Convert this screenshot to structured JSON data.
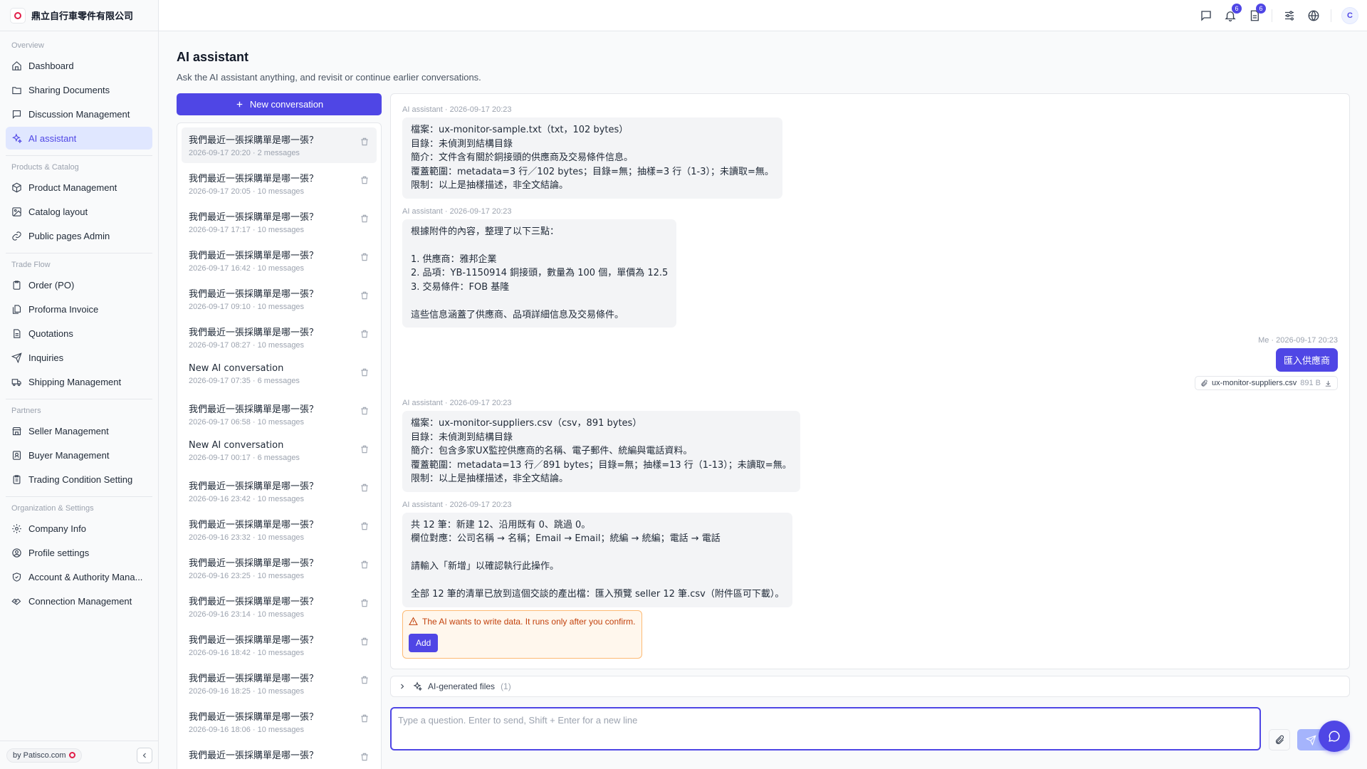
{
  "brand": {
    "name": "鼎立自行車零件有限公司"
  },
  "sidebar": {
    "sections": [
      {
        "title": "Overview",
        "items": [
          {
            "label": "Dashboard",
            "icon": "home-icon"
          },
          {
            "label": "Sharing Documents",
            "icon": "folder-icon"
          },
          {
            "label": "Discussion Management",
            "icon": "message-square-icon"
          },
          {
            "label": "AI assistant",
            "icon": "sparkles-icon",
            "active": true
          }
        ]
      },
      {
        "title": "Products & Catalog",
        "items": [
          {
            "label": "Product Management",
            "icon": "package-icon"
          },
          {
            "label": "Catalog layout",
            "icon": "image-icon"
          },
          {
            "label": "Public pages Admin",
            "icon": "link-icon"
          }
        ]
      },
      {
        "title": "Trade Flow",
        "items": [
          {
            "label": "Order (PO)",
            "icon": "clipboard-icon"
          },
          {
            "label": "Proforma Invoice",
            "icon": "files-icon"
          },
          {
            "label": "Quotations",
            "icon": "file-text-icon"
          },
          {
            "label": "Inquiries",
            "icon": "send-icon"
          },
          {
            "label": "Shipping Management",
            "icon": "truck-icon"
          }
        ]
      },
      {
        "title": "Partners",
        "items": [
          {
            "label": "Seller Management",
            "icon": "store-icon"
          },
          {
            "label": "Buyer Management",
            "icon": "contact-icon"
          },
          {
            "label": "Trading Condition Setting",
            "icon": "clipboard-list-icon"
          }
        ]
      },
      {
        "title": "Organization & Settings",
        "items": [
          {
            "label": "Company Info",
            "icon": "gear-icon"
          },
          {
            "label": "Profile settings",
            "icon": "user-circle-icon"
          },
          {
            "label": "Account & Authority Mana...",
            "icon": "shield-check-icon"
          },
          {
            "label": "Connection Management",
            "icon": "handshake-icon"
          }
        ]
      }
    ],
    "footer": {
      "by_label": "by Patisco.com"
    }
  },
  "topbar": {
    "notifications_count": "6",
    "documents_count": "6",
    "avatar_initial": "C"
  },
  "page": {
    "title": "AI assistant",
    "subtitle": "Ask the AI assistant anything, and revisit or continue earlier conversations.",
    "new_conversation_label": "New conversation"
  },
  "conversations": [
    {
      "title": "我們最近一張採購單是哪一張？",
      "meta": "2026-09-17 20:20 · 2 messages",
      "active": true
    },
    {
      "title": "我們最近一張採購單是哪一張？",
      "meta": "2026-09-17 20:05 · 10 messages"
    },
    {
      "title": "我們最近一張採購單是哪一張？",
      "meta": "2026-09-17 17:17 · 10 messages"
    },
    {
      "title": "我們最近一張採購單是哪一張？",
      "meta": "2026-09-17 16:42 · 10 messages"
    },
    {
      "title": "我們最近一張採購單是哪一張？",
      "meta": "2026-09-17 09:10 · 10 messages"
    },
    {
      "title": "我們最近一張採購單是哪一張？",
      "meta": "2026-09-17 08:27 · 10 messages"
    },
    {
      "title": "New AI conversation",
      "meta": "2026-09-17 07:35 · 6 messages"
    },
    {
      "title": "我們最近一張採購單是哪一張？",
      "meta": "2026-09-17 06:58 · 10 messages"
    },
    {
      "title": "New AI conversation",
      "meta": "2026-09-17 00:17 · 6 messages"
    },
    {
      "title": "我們最近一張採購單是哪一張？",
      "meta": "2026-09-16 23:42 · 10 messages"
    },
    {
      "title": "我們最近一張採購單是哪一張？",
      "meta": "2026-09-16 23:32 · 10 messages"
    },
    {
      "title": "我們最近一張採購單是哪一張？",
      "meta": "2026-09-16 23:25 · 10 messages"
    },
    {
      "title": "我們最近一張採購單是哪一張？",
      "meta": "2026-09-16 23:14 · 10 messages"
    },
    {
      "title": "我們最近一張採購單是哪一張？",
      "meta": "2026-09-16 18:42 · 10 messages"
    },
    {
      "title": "我們最近一張採購單是哪一張？",
      "meta": "2026-09-16 18:25 · 10 messages"
    },
    {
      "title": "我們最近一張採購單是哪一張？",
      "meta": "2026-09-16 18:06 · 10 messages"
    },
    {
      "title": "我們最近一張採購單是哪一張？",
      "meta": ""
    }
  ],
  "messages": [
    {
      "role": "ai",
      "header": "AI assistant · 2026-09-17 20:23",
      "text": "檔案：ux-monitor-sample.txt（txt，102 bytes）\n目錄：未偵測到結構目錄\n簡介：文件含有關於銅接頭的供應商及交易條件信息。\n覆蓋範圍：metadata=3 行／102 bytes；目錄=無；抽樣=3 行（1-3）；未讀取=無。\n限制：以上是抽樣描述，非全文結論。"
    },
    {
      "role": "ai",
      "header": "AI assistant · 2026-09-17 20:23",
      "text": "根據附件的內容，整理了以下三點：\n\n1. 供應商：雅邦企業\n2. 品項：YB-1150914 銅接頭，數量為 100 個，單價為 12.5\n3. 交易條件：FOB 基隆\n\n這些信息涵蓋了供應商、品項詳細信息及交易條件。"
    },
    {
      "role": "me",
      "header": "Me · 2026-09-17 20:23",
      "text": "匯入供應商",
      "attachment": {
        "name": "ux-monitor-suppliers.csv",
        "size": "891 B"
      }
    },
    {
      "role": "ai",
      "header": "AI assistant · 2026-09-17 20:23",
      "text": "檔案：ux-monitor-suppliers.csv（csv，891 bytes）\n目錄：未偵測到結構目錄\n簡介：包含多家UX監控供應商的名稱、電子郵件、統編與電話資料。\n覆蓋範圍：metadata=13 行／891 bytes；目錄=無；抽樣=13 行（1-13）；未讀取=無。\n限制：以上是抽樣描述，非全文結論。"
    },
    {
      "role": "ai",
      "header": "AI assistant · 2026-09-17 20:23",
      "text": "共 12 筆：新建 12、沿用既有 0、跳過 0。\n欄位對應：公司名稱 → 名稱；Email → Email；統編 → 統編；電話 → 電話\n\n請輸入「新增」以確認執行此操作。\n\n全部 12 筆的清單已放到這個交談的產出檔：匯入預覽 seller 12 筆.csv（附件區可下載）。",
      "confirm": {
        "text": "The AI wants to write data. It runs only after you confirm.",
        "button": "Add"
      }
    }
  ],
  "files_bar": {
    "label": "AI-generated files",
    "count": "(1)"
  },
  "composer": {
    "placeholder": "Type a question. Enter to send, Shift + Enter for a new line",
    "value": ""
  },
  "colors": {
    "accent": "#4f46e5",
    "warning_bg": "#fff7ed",
    "warning_text": "#c2410c"
  }
}
